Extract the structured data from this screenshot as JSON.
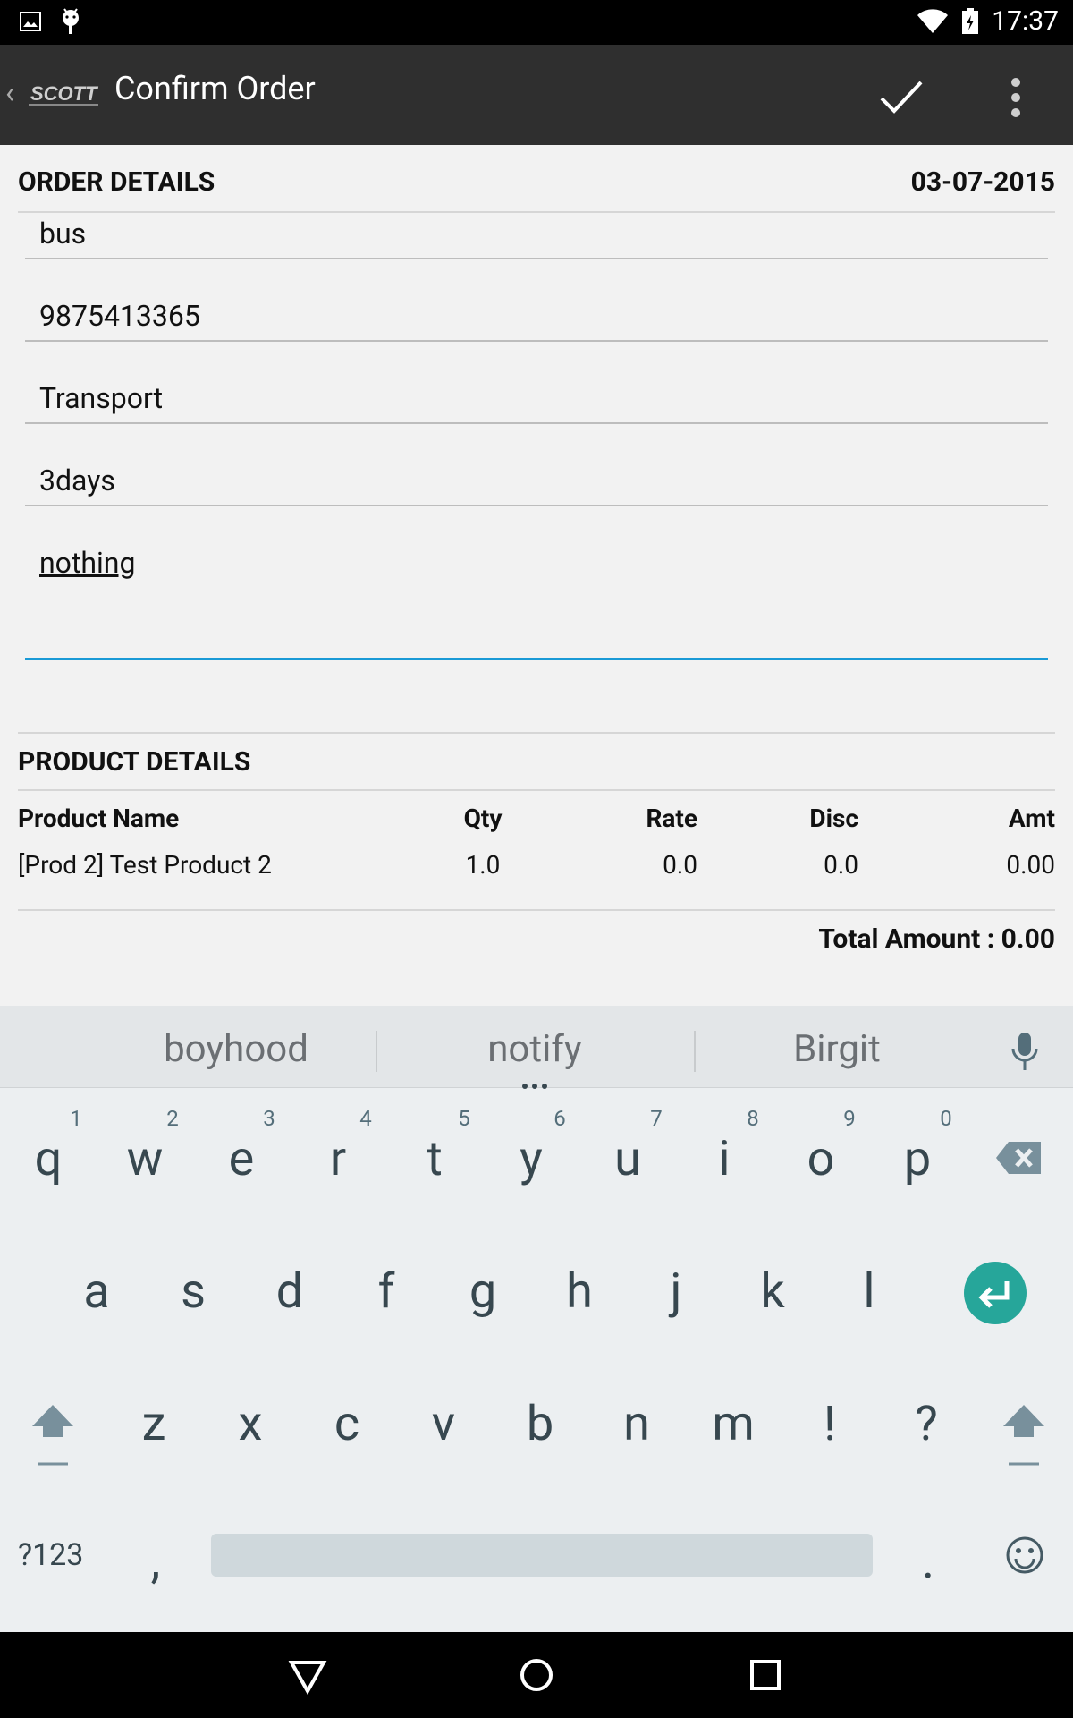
{
  "status_bar": {
    "time": "17:37"
  },
  "app_bar": {
    "back_glyph": "‹",
    "logo_text": "SCOTT",
    "title": "Confirm Order"
  },
  "order_details": {
    "heading": "ORDER DETAILS",
    "date": "03-07-2015",
    "fields": [
      "bus",
      "9875413365",
      "Transport",
      "3days",
      "nothing"
    ]
  },
  "product_details": {
    "heading": "PRODUCT DETAILS",
    "columns": [
      "Product Name",
      "Qty",
      "Rate",
      "Disc",
      "Amt"
    ],
    "rows": [
      {
        "name": "[Prod 2] Test Product 2",
        "qty": "1.0",
        "rate": "0.0",
        "disc": "0.0",
        "amt": "0.00"
      }
    ],
    "total": "Total Amount : 0.00"
  },
  "keyboard": {
    "suggestions": [
      "boyhood",
      "notify",
      "Birgit"
    ],
    "row1": [
      "q",
      "w",
      "e",
      "r",
      "t",
      "y",
      "u",
      "i",
      "o",
      "p"
    ],
    "row1_hints": [
      "1",
      "2",
      "3",
      "4",
      "5",
      "6",
      "7",
      "8",
      "9",
      "0"
    ],
    "row2": [
      "a",
      "s",
      "d",
      "f",
      "g",
      "h",
      "j",
      "k",
      "l"
    ],
    "row3": [
      "z",
      "x",
      "c",
      "v",
      "b",
      "n",
      "m",
      "!",
      "?"
    ],
    "symbols_key": "?123",
    "comma_key": ",",
    "period_key": "."
  },
  "colors": {
    "accent": "#1a9ad6",
    "enter_key": "#26a69a",
    "app_bar": "#2f2f2f"
  }
}
